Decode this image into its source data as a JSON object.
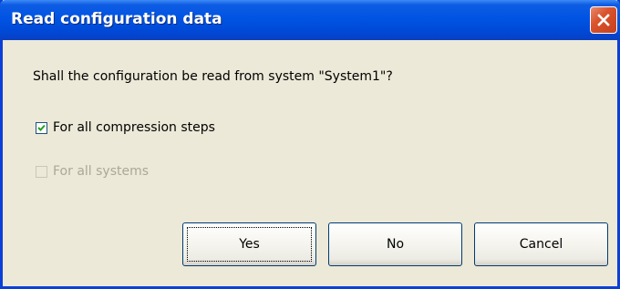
{
  "window": {
    "title": "Read configuration data",
    "close_icon": "close-icon"
  },
  "dialog": {
    "message": "Shall the configuration be read from system \"System1\"?",
    "options": [
      {
        "label": "For all compression steps",
        "checked": true,
        "enabled": true
      },
      {
        "label": "For all systems",
        "checked": false,
        "enabled": false
      }
    ]
  },
  "buttons": {
    "yes_label": "Yes",
    "no_label": "No",
    "cancel_label": "Cancel",
    "default": "Yes"
  },
  "colors": {
    "titlebar": "#0054e3",
    "close_button": "#d9532c",
    "dialog_background": "#ece9d8",
    "disabled_text": "#aca899"
  }
}
